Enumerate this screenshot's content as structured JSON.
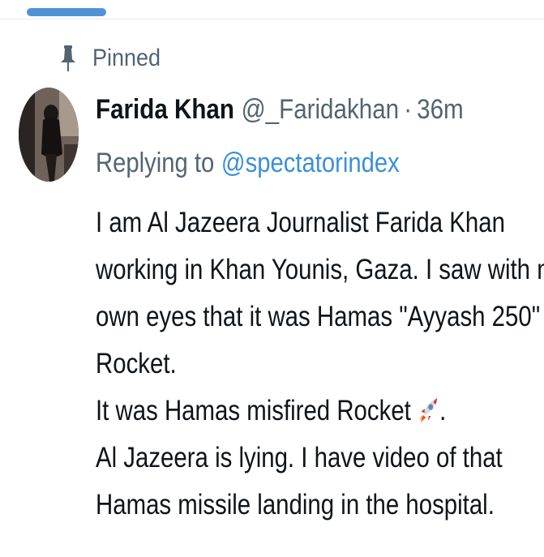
{
  "pinned": {
    "icon": "pin-icon",
    "label": "Pinned"
  },
  "tweet": {
    "author": {
      "name": "Farida Khan",
      "handle": "@_Faridakhan",
      "avatar_icon": "avatar"
    },
    "separator": "·",
    "time": "36m",
    "reply": {
      "prefix": "Replying to",
      "handle": "@spectatorindex"
    },
    "body_lines": [
      "I am Al Jazeera Journalist Farida Khan",
      "working in Khan Younis, Gaza. I saw with my",
      "own eyes that it was Hamas \"Ayyash 250\"",
      "Rocket.",
      "It was Hamas misfired Rocket",
      "Al Jazeera is lying. I have video of that",
      "Hamas missile landing in the hospital."
    ],
    "emoji_after_line_5": "rocket-emoji",
    "line_5_end": "."
  },
  "colors": {
    "accent": "#3b8fd9",
    "tab_indicator": "#4f93d6",
    "secondary_text": "#536471",
    "primary_text": "#0f1419"
  }
}
